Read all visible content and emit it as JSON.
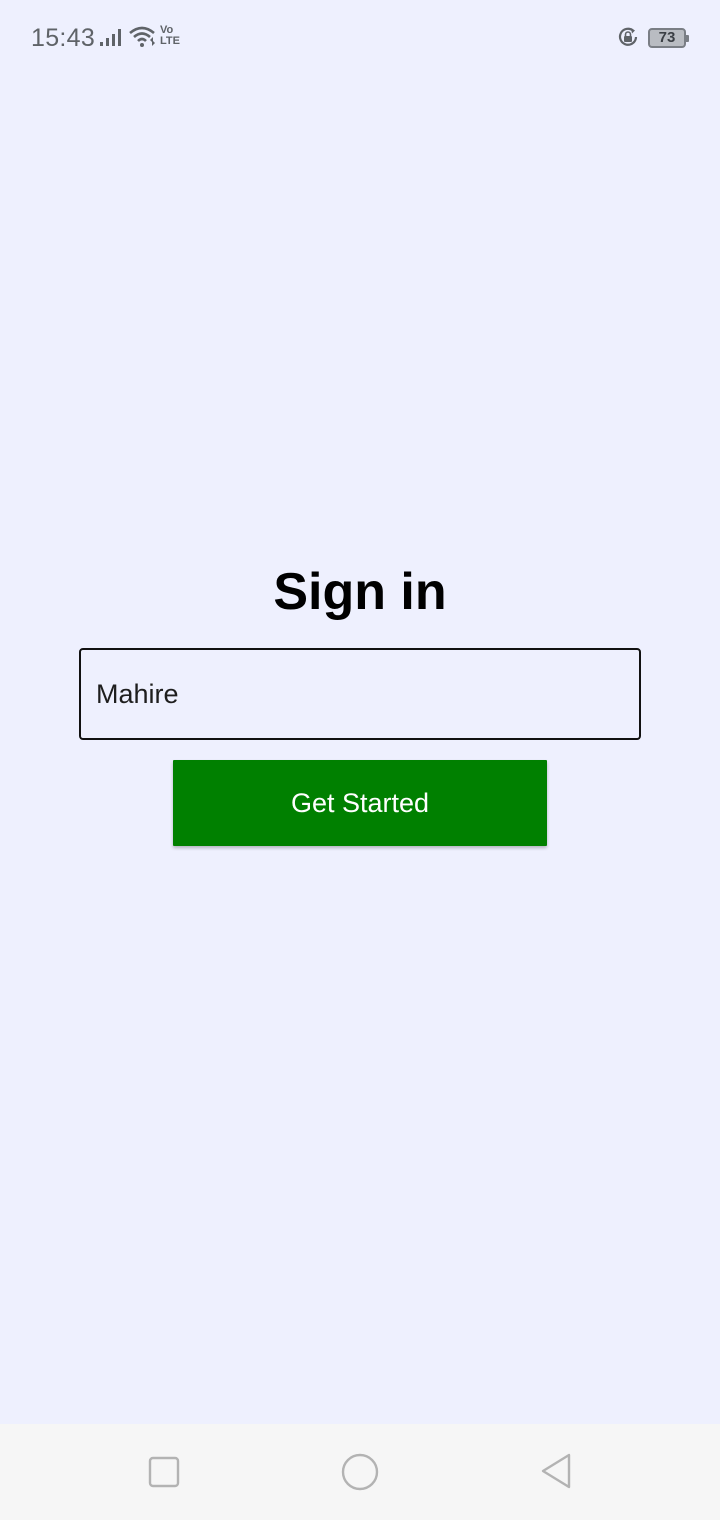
{
  "status_bar": {
    "time": "15:43",
    "volte_top": "Vo",
    "volte_bottom": "LTE",
    "battery_level": "73"
  },
  "signin": {
    "title": "Sign in",
    "name_value": "Mahire",
    "button_label": "Get Started",
    "button_color": "#008000"
  },
  "nav": {
    "items": [
      "square-recents-icon",
      "circle-home-icon",
      "triangle-back-icon"
    ]
  }
}
